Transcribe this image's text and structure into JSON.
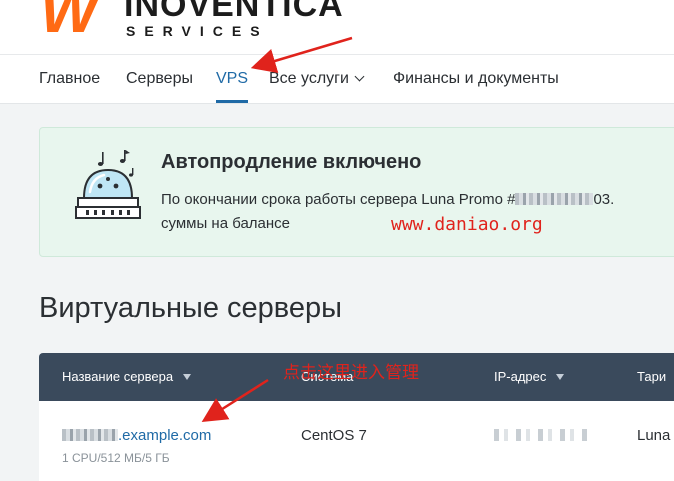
{
  "header": {
    "logo_mark": "W",
    "logo_name": "INOVENTICA",
    "logo_sub": "SERVICES"
  },
  "nav": {
    "items": [
      {
        "label": "Главное"
      },
      {
        "label": "Серверы"
      },
      {
        "label": "VPS",
        "active": true
      },
      {
        "label": "Все услуги"
      },
      {
        "label": "Финансы и документы"
      }
    ]
  },
  "alert": {
    "title": "Автопродление включено",
    "text_prefix": "По окончании срока работы сервера Luna Promo #",
    "text_tail": "03.",
    "text_line2": "суммы на балансе"
  },
  "watermark": "www.daniao.org",
  "page": {
    "title": "Виртуальные серверы"
  },
  "table": {
    "columns": [
      {
        "label": "Название сервера"
      },
      {
        "label": "Система"
      },
      {
        "label": "IP-адрес"
      },
      {
        "label": "Тари"
      }
    ],
    "rows": [
      {
        "name_suffix": ".example.com",
        "spec": "1 CPU/512 МБ/5 ГБ",
        "system": "CentOS 7",
        "tariff": "Luna"
      }
    ]
  },
  "annotation": {
    "text": "点击这里进入管理"
  },
  "colors": {
    "accent": "#1f6aa6",
    "alert_bg": "#e8f6ee",
    "table_header": "#3a4a5c",
    "annotation_red": "#e0231c",
    "logo_orange": "#ff6a14"
  }
}
